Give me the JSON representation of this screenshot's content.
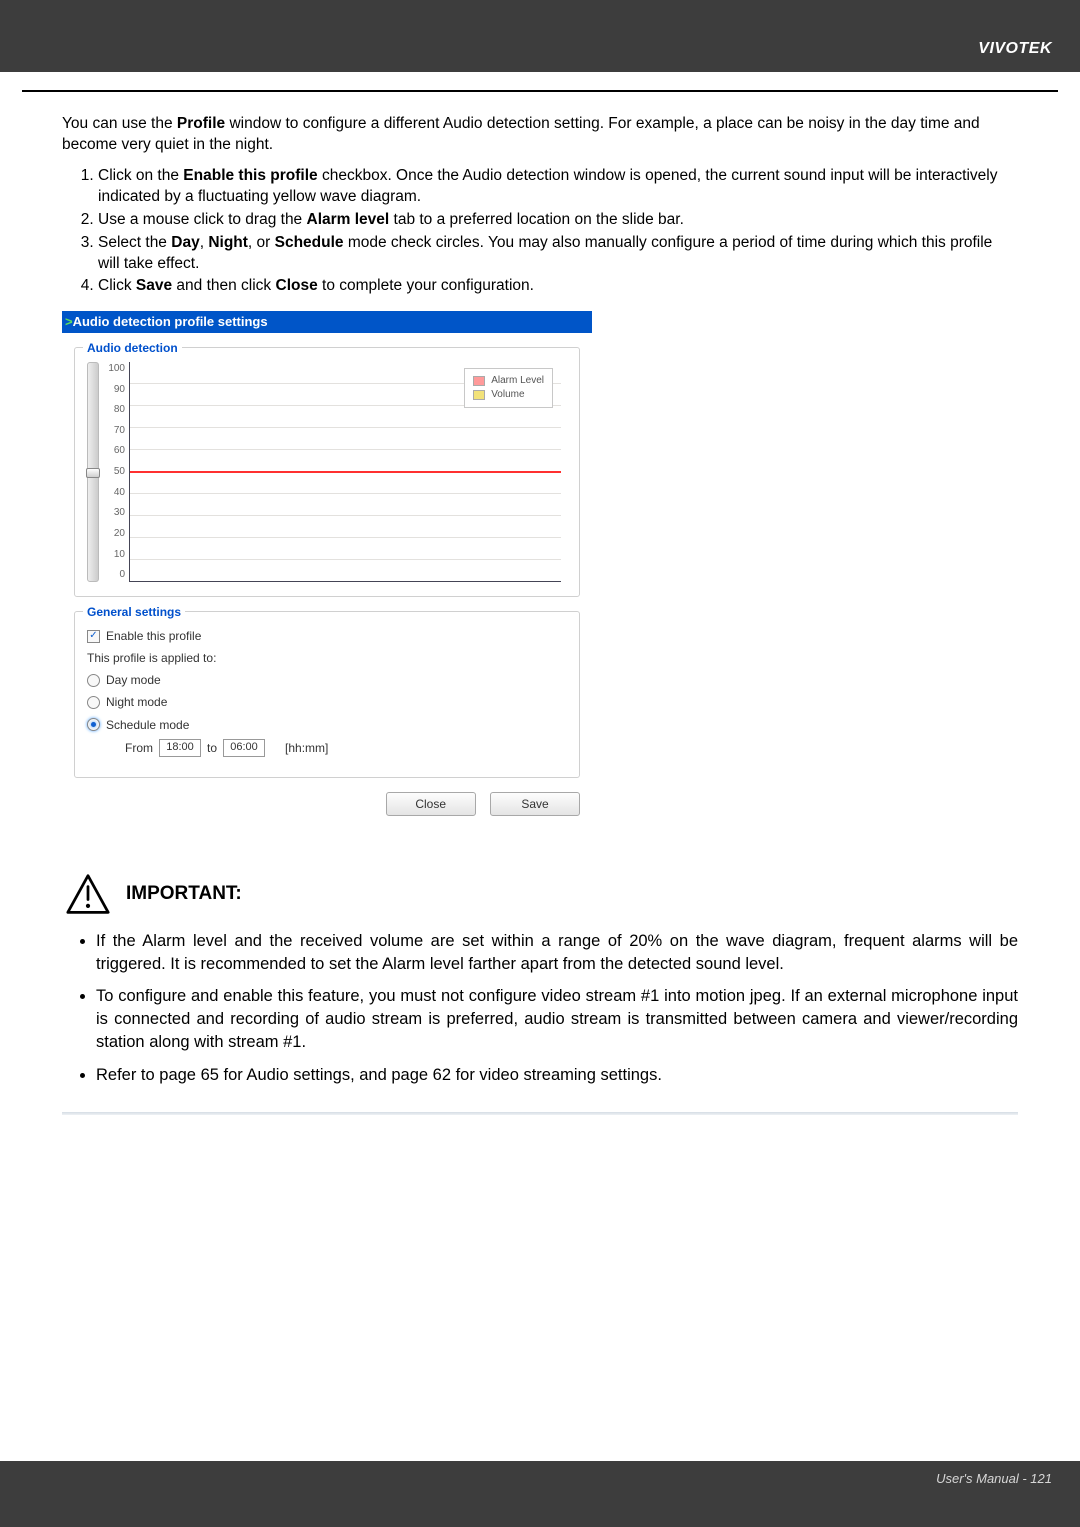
{
  "header": {
    "brand": "VIVOTEK"
  },
  "intro": {
    "pre": "You can use the ",
    "bold1": "Profile",
    "post": " window to configure a different Audio detection setting. For example, a place can be noisy in the day time and become very quiet in the night."
  },
  "steps": [
    {
      "pre": "Click on the ",
      "b": "Enable this profile",
      "post": " checkbox. Once the Audio detection window is opened, the current sound input will be interactively indicated by a fluctuating yellow wave diagram."
    },
    {
      "pre": "Use a mouse click to drag the ",
      "b": "Alarm level",
      "post": " tab to a preferred location on the slide bar."
    },
    {
      "pre": "Select the ",
      "b": "Day",
      "mid1": ", ",
      "b2": "Night",
      "mid2": ", or ",
      "b3": "Schedule",
      "post": " mode check circles. You may also manually configure a period of time during which this profile will take effect."
    },
    {
      "pre": "Click ",
      "b": "Save",
      "mid1": " and then click ",
      "b2": "Close",
      "post": " to complete your configuration."
    }
  ],
  "panel": {
    "titlebar": "Audio detection profile settings",
    "audio_legend": "Audio detection",
    "legend_rows": {
      "alarm": "Alarm Level",
      "volume": "Volume"
    },
    "general_legend": "General settings",
    "enable_label": "Enable this profile",
    "applied_label": "This profile is applied to:",
    "day_label": "Day mode",
    "night_label": "Night mode",
    "sched_label": "Schedule mode",
    "from_label": "From",
    "from_value": "18:00",
    "to_label": "to",
    "to_value": "06:00",
    "hhmm": "[hh:mm]",
    "close": "Close",
    "save": "Save"
  },
  "important": {
    "title": "IMPORTANT:",
    "items": [
      "If the Alarm level and the received volume are set within a range of 20% on the wave diagram, frequent alarms will be triggered. It is recommended to set the Alarm level farther apart from the detected sound level.",
      "To configure and enable this feature, you must not configure video stream #1 into motion jpeg. If an external microphone input is connected and recording of audio stream is preferred, audio stream is transmitted between camera and viewer/recording station along with stream #1.",
      "Refer to page 65 for Audio settings, and page 62 for video streaming settings."
    ]
  },
  "footer": {
    "page": "User's Manual - 121"
  },
  "chart_data": {
    "type": "line",
    "title": "Audio detection",
    "ylabel": "",
    "xlabel": "",
    "ylim": [
      0,
      100
    ],
    "y_ticks": [
      0,
      10,
      20,
      30,
      40,
      50,
      60,
      70,
      80,
      90,
      100
    ],
    "series": [
      {
        "name": "Alarm Level",
        "values": [
          50
        ],
        "note": "constant horizontal threshold line at y≈50"
      },
      {
        "name": "Volume",
        "values": [],
        "note": "live volume trace, currently empty"
      }
    ],
    "legend_position": "top-right"
  }
}
